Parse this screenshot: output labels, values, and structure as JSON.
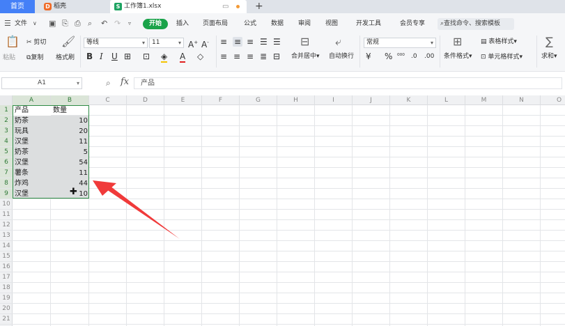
{
  "titlebar": {
    "home_tab": "首页",
    "tabs": [
      {
        "label": "稻壳",
        "badge": "D"
      },
      {
        "label": "工作簿1.xlsx",
        "badge": "S"
      }
    ],
    "new_tab": "+"
  },
  "menubar": {
    "file": "文件",
    "items": [
      "开始",
      "插入",
      "页面布局",
      "公式",
      "数据",
      "审阅",
      "视图",
      "开发工具",
      "会员专享"
    ],
    "search_placeholder": "查找命令、搜索模板"
  },
  "ribbon": {
    "paste": "粘贴",
    "cut": "剪切",
    "copy": "复制",
    "format_painter": "格式刷",
    "font_name": "等线",
    "font_size": "11",
    "merge_center": "合并居中",
    "wrap_text": "自动换行",
    "number_format": "常规",
    "conditional_format": "条件格式",
    "table_style": "表格样式",
    "cell_style": "单元格样式",
    "sum": "求和"
  },
  "formula_bar": {
    "name_box": "A1",
    "fx": "fx",
    "content": "产品"
  },
  "grid": {
    "columns": [
      "A",
      "B",
      "C",
      "D",
      "E",
      "F",
      "G",
      "H",
      "I",
      "J",
      "K",
      "L",
      "M",
      "N",
      "O"
    ],
    "rows": [
      "1",
      "2",
      "3",
      "4",
      "5",
      "6",
      "7",
      "8",
      "9",
      "10",
      "11",
      "12",
      "13",
      "14",
      "15",
      "16",
      "17",
      "18",
      "19",
      "20",
      "21"
    ],
    "header": [
      "产品",
      "数量"
    ],
    "data": [
      [
        "奶茶",
        "10"
      ],
      [
        "玩具",
        "20"
      ],
      [
        "汉堡",
        "11"
      ],
      [
        "奶茶",
        "5"
      ],
      [
        "汉堡",
        "54"
      ],
      [
        "薯条",
        "11"
      ],
      [
        "炸鸡",
        "44"
      ],
      [
        "汉堡",
        "10"
      ]
    ],
    "selection": "A1:B9"
  },
  "colors": {
    "accent": "#4480f7",
    "start_button": "#1aa34a",
    "selection_border": "#2e8b45",
    "annotation_arrow": "#f03a3a"
  }
}
